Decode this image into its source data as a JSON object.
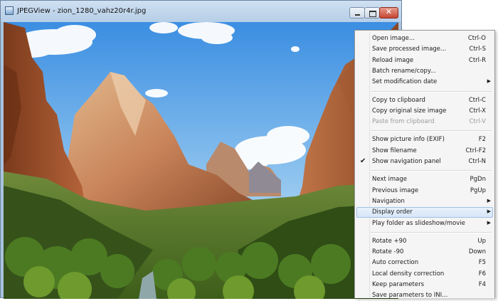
{
  "window": {
    "title": "JPEGView - zion_1280_vahz20r4r.jpg",
    "icon": "jpegview-app-icon",
    "controls": [
      "minimize-icon",
      "maximize-icon",
      "close-icon"
    ],
    "close_glyph": "✕"
  },
  "image": {
    "description_icon": "photo-canvas",
    "colors": {
      "sky_top": "#3f8fe0",
      "sky_bottom": "#cfe5f5",
      "cliff": "#b0603a",
      "forest": "#3f6b1e"
    }
  },
  "menu": {
    "items": [
      {
        "id": "open-image",
        "label": "Open image...",
        "shortcut": "Ctrl-O"
      },
      {
        "id": "save-processed-image",
        "label": "Save processed image...",
        "shortcut": "Ctrl-S"
      },
      {
        "id": "reload-image",
        "label": "Reload image",
        "shortcut": "Ctrl-R"
      },
      {
        "id": "batch-rename-copy",
        "label": "Batch rename/copy...",
        "shortcut": ""
      },
      {
        "id": "set-modification-date",
        "label": "Set modification date",
        "shortcut": "",
        "submenu": true
      },
      {
        "separator": true
      },
      {
        "id": "copy-to-clipboard",
        "label": "Copy to clipboard",
        "shortcut": "Ctrl-C"
      },
      {
        "id": "copy-original-size-image",
        "label": "Copy original size image",
        "shortcut": "Ctrl-X"
      },
      {
        "id": "paste-from-clipboard",
        "label": "Paste from clipboard",
        "shortcut": "Ctrl-V",
        "disabled": true
      },
      {
        "separator": true
      },
      {
        "id": "show-picture-info",
        "label": "Show picture info (EXIF)",
        "shortcut": "F2"
      },
      {
        "id": "show-filename",
        "label": "Show filename",
        "shortcut": "Ctrl-F2"
      },
      {
        "id": "show-navigation-panel",
        "label": "Show navigation panel",
        "shortcut": "Ctrl-N",
        "checked": true
      },
      {
        "separator": true
      },
      {
        "id": "next-image",
        "label": "Next image",
        "shortcut": "PgDn"
      },
      {
        "id": "previous-image",
        "label": "Previous image",
        "shortcut": "PgUp"
      },
      {
        "id": "navigation",
        "label": "Navigation",
        "shortcut": "",
        "submenu": true
      },
      {
        "id": "display-order",
        "label": "Display order",
        "shortcut": "",
        "submenu": true,
        "highlighted": true
      },
      {
        "id": "play-folder-as-slideshow",
        "label": "Play folder as slideshow/movie",
        "shortcut": "",
        "submenu": true
      },
      {
        "separator": true
      },
      {
        "id": "rotate-plus-90",
        "label": "Rotate +90",
        "shortcut": "Up"
      },
      {
        "id": "rotate-minus-90",
        "label": "Rotate -90",
        "shortcut": "Down"
      },
      {
        "id": "auto-correction",
        "label": "Auto correction",
        "shortcut": "F5"
      },
      {
        "id": "local-density-correction",
        "label": "Local density correction",
        "shortcut": "F6"
      },
      {
        "id": "keep-parameters",
        "label": "Keep parameters",
        "shortcut": "F4"
      },
      {
        "id": "save-parameters-to-ini",
        "label": "Save parameters to INI...",
        "shortcut": ""
      }
    ],
    "check_glyph": "✔",
    "submenu_glyph": "▶",
    "highlight_color": "#d7e6f8"
  }
}
